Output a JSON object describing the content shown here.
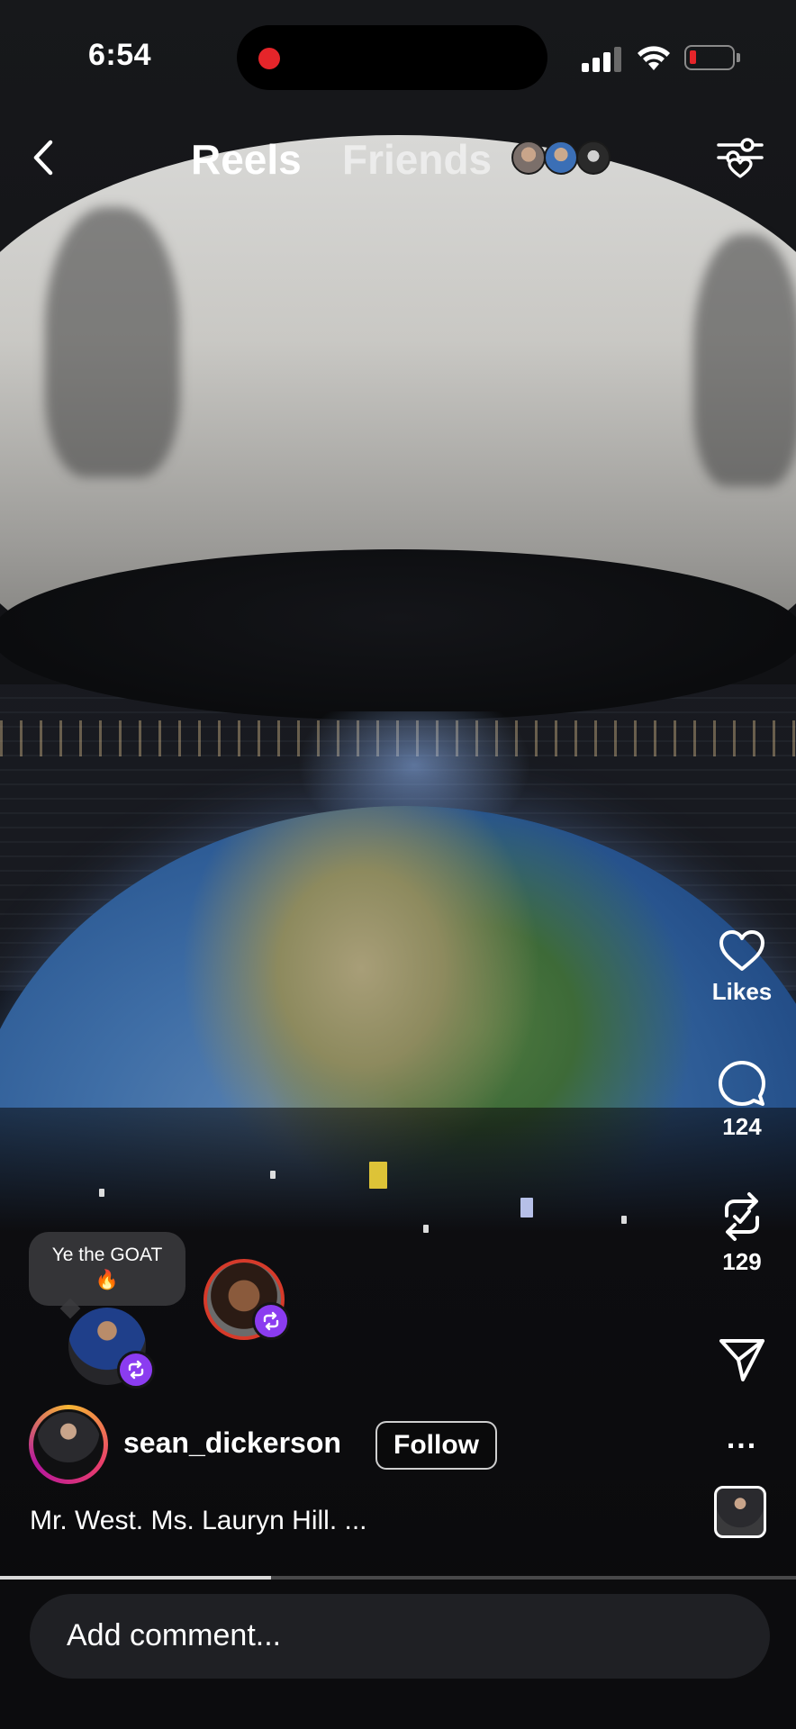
{
  "status_bar": {
    "time": "6:54",
    "battery_color": "#e5252a"
  },
  "nav": {
    "back_icon": "chevron-left-icon",
    "tabs": [
      {
        "label": "Reels",
        "active": true
      },
      {
        "label": "Friends",
        "active": false
      }
    ],
    "filter_icon": "filter-sliders-heart-icon"
  },
  "actions": {
    "likes": {
      "icon": "heart-icon",
      "label": "Likes"
    },
    "comments": {
      "icon": "comment-bubble-icon",
      "count": "124"
    },
    "reposts": {
      "icon": "repost-icon",
      "count": "129"
    },
    "share": {
      "icon": "send-icon"
    },
    "more": {
      "icon": "more-horizontal-icon",
      "label": "..."
    }
  },
  "friend_activity": {
    "note_text": "Ye the GOAT",
    "note_emoji": "🔥"
  },
  "post": {
    "username": "sean_dickerson",
    "follow_label": "Follow",
    "caption": "Mr. West. Ms. Lauryn Hill. ...",
    "progress": 0.34
  },
  "comment": {
    "placeholder": "Add comment..."
  },
  "colors": {
    "repost_badge": "#8b3cf0",
    "story_ring": [
      "#f7b733",
      "#e93e6b",
      "#b5179e"
    ]
  }
}
